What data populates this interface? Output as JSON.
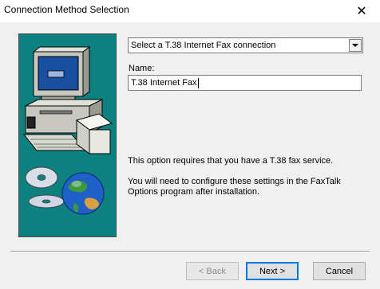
{
  "window": {
    "title": "Connection Method Selection",
    "close_glyph": "✕"
  },
  "connection_select": {
    "selected": "Select a T.38 Internet Fax connection"
  },
  "name_field": {
    "label": "Name:",
    "value": "T.38 Internet Fax"
  },
  "info": {
    "line1": "This option requires that you have a T.38 fax service.",
    "line2": "You will need to configure these settings in the FaxTalk Options program after installation."
  },
  "buttons": {
    "back": "< Back",
    "next": "Next >",
    "cancel": "Cancel"
  },
  "colors": {
    "side_panel": "#0d8080",
    "accent": "#0078d7"
  }
}
